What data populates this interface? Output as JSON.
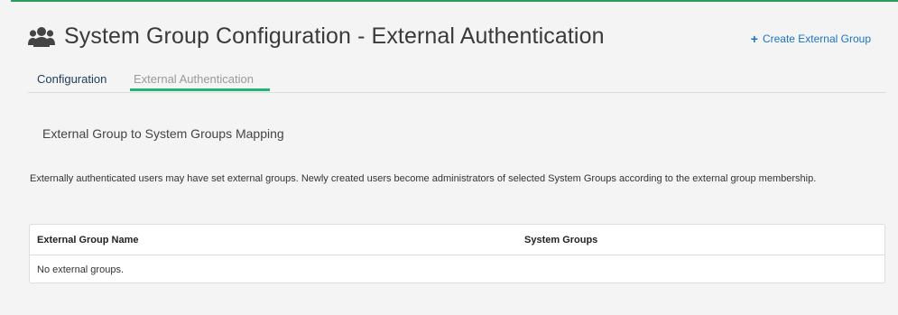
{
  "header": {
    "title": "System Group Configuration - External Authentication",
    "icon": "users-group-icon",
    "create_button": {
      "icon": "plus-icon",
      "label": "Create External Group"
    }
  },
  "tabs": [
    {
      "label": "Configuration",
      "active": false
    },
    {
      "label": "External Authentication",
      "active": true
    }
  ],
  "section": {
    "title": "External Group to System Groups Mapping",
    "description": "Externally authenticated users may have set external groups. Newly created users become administrators of selected System Groups according to the external group membership."
  },
  "table": {
    "columns": [
      "External Group Name",
      "System Groups"
    ],
    "empty_message": "No external groups."
  },
  "colors": {
    "accent": "#21b573",
    "link": "#1a73c7",
    "top_rule": "#2e9b5f"
  }
}
